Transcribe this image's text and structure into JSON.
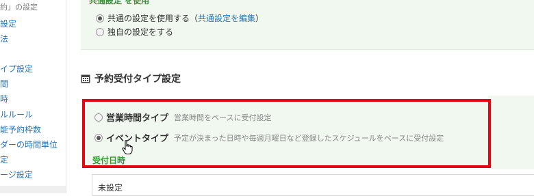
{
  "sidebar": {
    "header": "約」の設定",
    "items": [
      {
        "label": "設定"
      },
      {
        "label": "法"
      },
      {
        "label": "イプ設定"
      },
      {
        "label": "間"
      },
      {
        "label": "時"
      },
      {
        "label": "ルルール"
      },
      {
        "label": "能予約枠数"
      },
      {
        "label": "ダーの時間単位"
      },
      {
        "label": "定"
      },
      {
        "label": "ージ設定"
      }
    ]
  },
  "top_panel": {
    "fragment": "共通設定 を使用",
    "use_common": {
      "label": "共通の設定を使用する（",
      "link": "共通設定を編集",
      "suffix": "）",
      "selected": true
    },
    "own_setting": {
      "label": "独自の設定をする",
      "selected": false
    }
  },
  "section": {
    "title": "予約受付タイプ設定",
    "icon": "calendar-icon"
  },
  "reservation_types": [
    {
      "label": "営業時間タイプ",
      "description": "営業時間をベースに受付設定",
      "selected": false
    },
    {
      "label": "イベントタイプ",
      "description": "予定が決まった日時や毎週月曜日など登録したスケジュールをベースに受付設定",
      "selected": true
    }
  ],
  "reception_datetime": {
    "label": "受付日時",
    "value": "未設定"
  },
  "colors": {
    "link": "#2a73b3",
    "highlight": "#e30613",
    "panel_bg": "#f1f8ef",
    "green_label": "#2f9a2f"
  }
}
